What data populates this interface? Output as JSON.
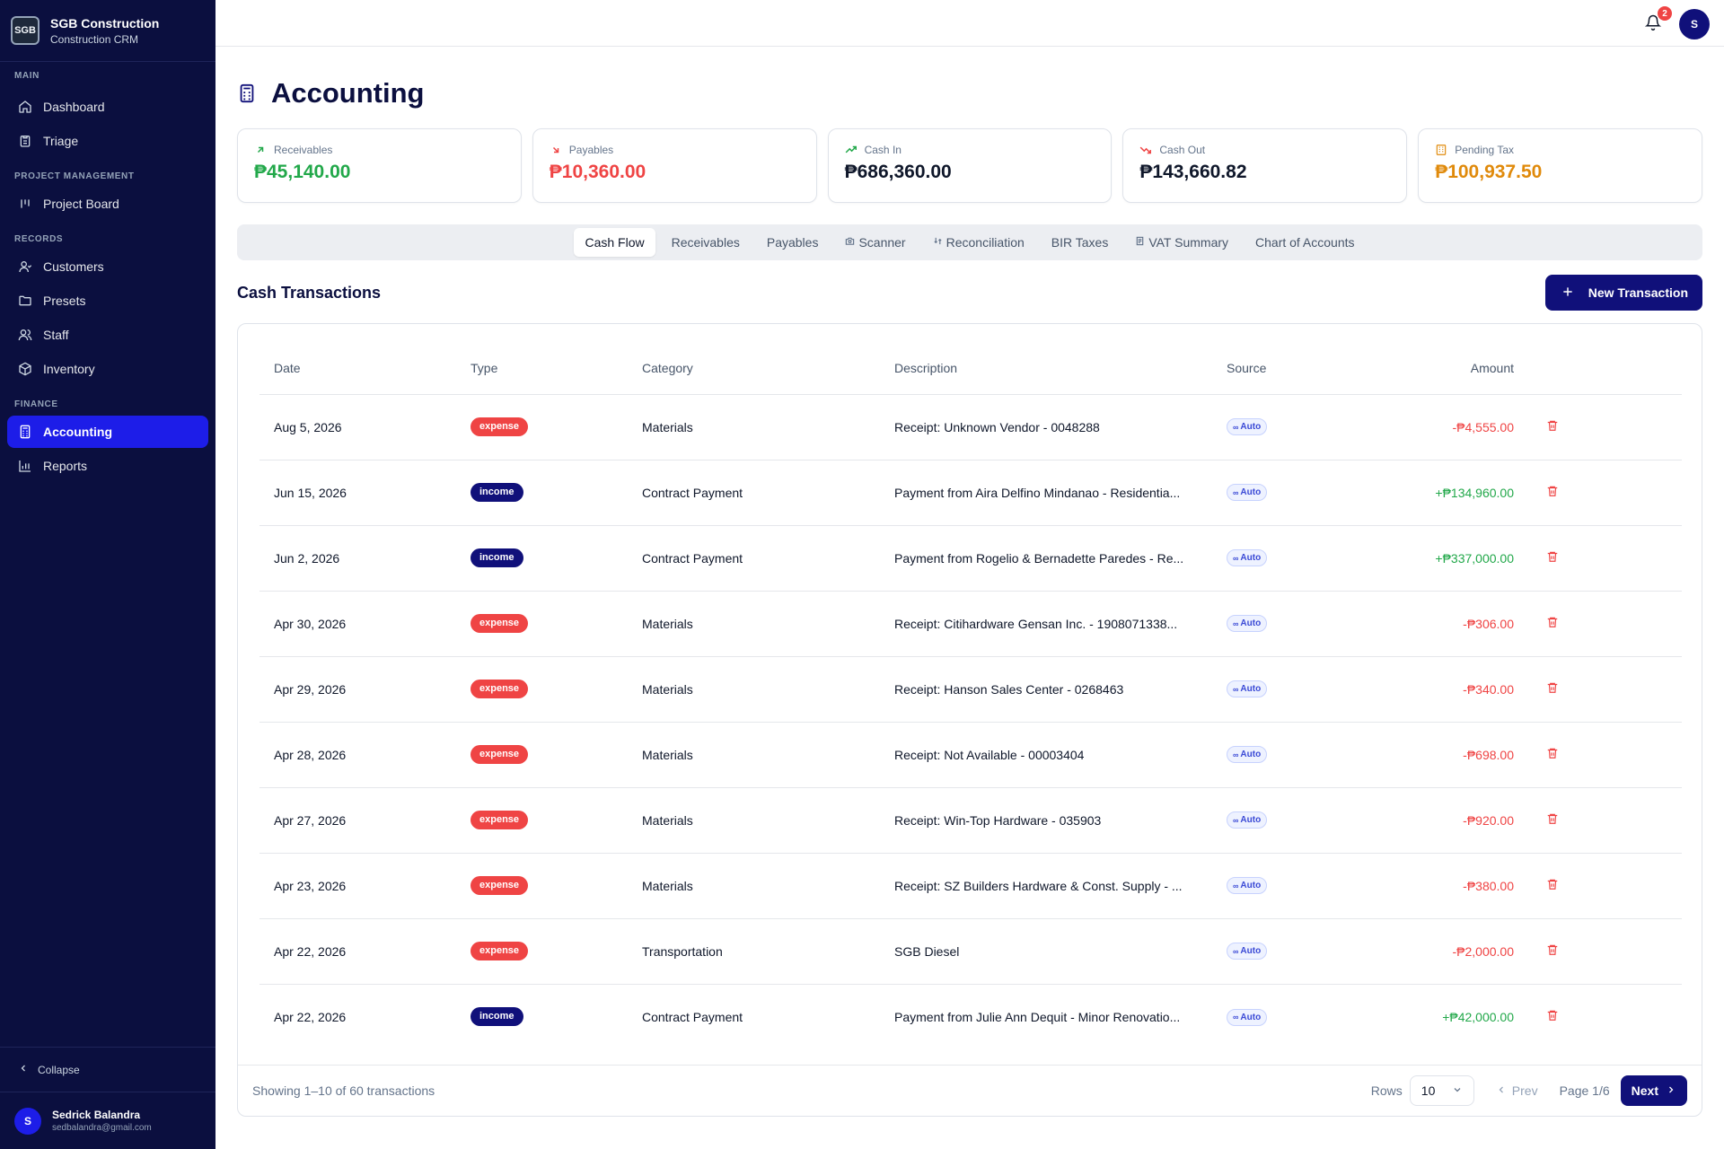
{
  "brand": {
    "logo_text": "SGB",
    "name": "SGB Construction",
    "subtitle": "Construction CRM"
  },
  "sidebar": {
    "sections": [
      {
        "label": "MAIN",
        "items": [
          {
            "label": "Dashboard",
            "icon": "home-icon"
          },
          {
            "label": "Triage",
            "icon": "clipboard-icon"
          }
        ]
      },
      {
        "label": "PROJECT MANAGEMENT",
        "items": [
          {
            "label": "Project Board",
            "icon": "kanban-icon"
          }
        ]
      },
      {
        "label": "RECORDS",
        "items": [
          {
            "label": "Customers",
            "icon": "user-icon"
          },
          {
            "label": "Presets",
            "icon": "folder-icon"
          },
          {
            "label": "Staff",
            "icon": "users-icon"
          },
          {
            "label": "Inventory",
            "icon": "box-icon"
          }
        ]
      },
      {
        "label": "FINANCE",
        "items": [
          {
            "label": "Accounting",
            "icon": "calculator-icon",
            "active": true
          },
          {
            "label": "Reports",
            "icon": "bar-chart-icon"
          }
        ]
      }
    ],
    "collapse_label": "Collapse",
    "user": {
      "initial": "S",
      "name": "Sedrick Balandra",
      "email": "sedbalandra@gmail.com"
    }
  },
  "topbar": {
    "notification_count": "2",
    "avatar_initial": "S"
  },
  "page": {
    "title": "Accounting"
  },
  "stats": [
    {
      "label": "Receivables",
      "value": "₱45,140.00",
      "color": "#22a84a",
      "icon": "arrow-up-right-icon"
    },
    {
      "label": "Payables",
      "value": "₱10,360.00",
      "color": "#ef4444",
      "icon": "arrow-down-right-icon"
    },
    {
      "label": "Cash In",
      "value": "₱686,360.00",
      "color": "#0f172a",
      "icon": "trending-up-icon"
    },
    {
      "label": "Cash Out",
      "value": "₱143,660.82",
      "color": "#0f172a",
      "icon": "trending-down-icon"
    },
    {
      "label": "Pending Tax",
      "value": "₱100,937.50",
      "color": "#e08a0b",
      "icon": "building-icon"
    }
  ],
  "tabs": [
    {
      "label": "Cash Flow",
      "active": true
    },
    {
      "label": "Receivables"
    },
    {
      "label": "Payables"
    },
    {
      "label": "Scanner",
      "icon": "camera-icon"
    },
    {
      "label": "Reconciliation",
      "icon": "swap-icon"
    },
    {
      "label": "BIR Taxes"
    },
    {
      "label": "VAT Summary",
      "icon": "receipt-icon"
    },
    {
      "label": "Chart of Accounts"
    }
  ],
  "section": {
    "title": "Cash Transactions",
    "new_button": "New Transaction"
  },
  "table": {
    "headers": {
      "date": "Date",
      "type": "Type",
      "category": "Category",
      "description": "Description",
      "source": "Source",
      "amount": "Amount"
    },
    "rows": [
      {
        "date": "Aug 5, 2026",
        "type": "expense",
        "category": "Materials",
        "description": "Receipt: Unknown Vendor - 0048288",
        "source": "Auto",
        "amount": "-₱4,555.00"
      },
      {
        "date": "Jun 15, 2026",
        "type": "income",
        "category": "Contract Payment",
        "description": "Payment from Aira Delfino Mindanao - Residentia...",
        "source": "Auto",
        "amount": "+₱134,960.00"
      },
      {
        "date": "Jun 2, 2026",
        "type": "income",
        "category": "Contract Payment",
        "description": "Payment from Rogelio & Bernadette Paredes - Re...",
        "source": "Auto",
        "amount": "+₱337,000.00"
      },
      {
        "date": "Apr 30, 2026",
        "type": "expense",
        "category": "Materials",
        "description": "Receipt: Citihardware Gensan Inc. - 1908071338...",
        "source": "Auto",
        "amount": "-₱306.00"
      },
      {
        "date": "Apr 29, 2026",
        "type": "expense",
        "category": "Materials",
        "description": "Receipt: Hanson Sales Center - 0268463",
        "source": "Auto",
        "amount": "-₱340.00"
      },
      {
        "date": "Apr 28, 2026",
        "type": "expense",
        "category": "Materials",
        "description": "Receipt: Not Available - 00003404",
        "source": "Auto",
        "amount": "-₱698.00"
      },
      {
        "date": "Apr 27, 2026",
        "type": "expense",
        "category": "Materials",
        "description": "Receipt: Win-Top Hardware - 035903",
        "source": "Auto",
        "amount": "-₱920.00"
      },
      {
        "date": "Apr 23, 2026",
        "type": "expense",
        "category": "Materials",
        "description": "Receipt: SZ Builders Hardware & Const. Supply - ...",
        "source": "Auto",
        "amount": "-₱380.00"
      },
      {
        "date": "Apr 22, 2026",
        "type": "expense",
        "category": "Transportation",
        "description": "SGB Diesel",
        "source": "Auto",
        "amount": "-₱2,000.00"
      },
      {
        "date": "Apr 22, 2026",
        "type": "income",
        "category": "Contract Payment",
        "description": "Payment from Julie Ann Dequit - Minor Renovatio...",
        "source": "Auto",
        "amount": "+₱42,000.00"
      }
    ]
  },
  "pagination": {
    "showing": "Showing 1–10 of 60 transactions",
    "rows_label": "Rows",
    "rows_value": "10",
    "prev": "Prev",
    "page": "Page 1/6",
    "next": "Next"
  }
}
